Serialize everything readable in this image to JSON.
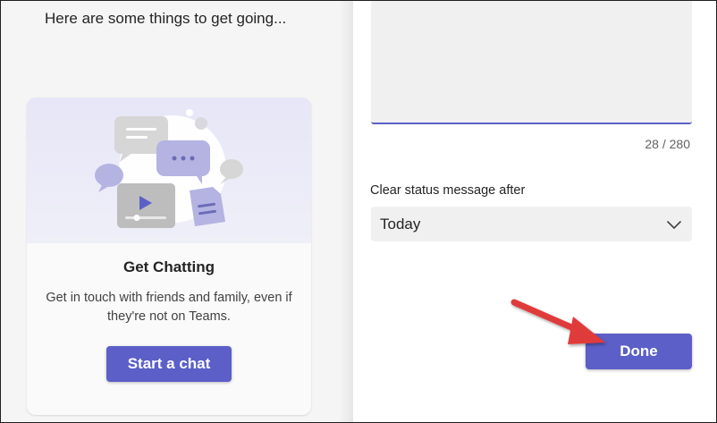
{
  "left_panel": {
    "intro_text": "Here are some things to get going...",
    "card": {
      "title": "Get Chatting",
      "description": "Get in touch with friends and family, even if they're not on Teams.",
      "button_label": "Start a chat",
      "illustration": "chat-bubbles-illustration"
    }
  },
  "right_panel": {
    "status_message": {
      "value": "",
      "char_count": "28 / 280"
    },
    "clear_after": {
      "label": "Clear status message after",
      "selected": "Today",
      "icon": "chevron-down-icon"
    },
    "done_label": "Done"
  },
  "annotation": {
    "icon": "red-arrow-icon",
    "color": "#e03a3a"
  },
  "colors": {
    "accent": "#5b5fc7",
    "pane_bg": "#f5f5f5",
    "card_hero_bg": "#e7e6f7",
    "field_bg": "#f0f0f0"
  }
}
